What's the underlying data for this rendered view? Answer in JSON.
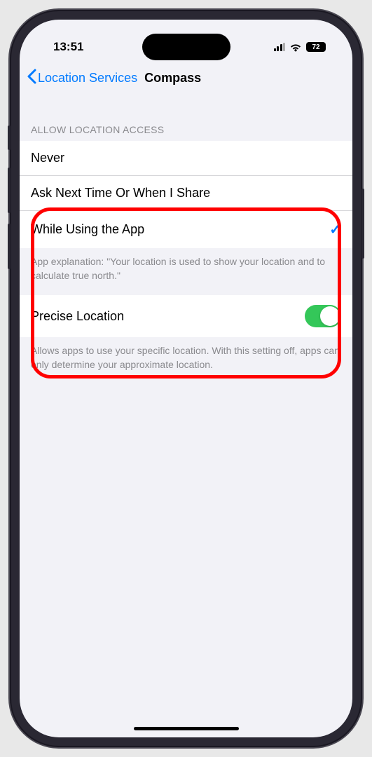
{
  "status": {
    "time": "13:51",
    "battery": "72"
  },
  "nav": {
    "back_label": "Location Services",
    "title": "Compass"
  },
  "section": {
    "header": "ALLOW LOCATION ACCESS",
    "options": {
      "never": "Never",
      "ask": "Ask Next Time Or When I Share",
      "while": "While Using the App"
    },
    "app_explanation": "App explanation: \"Your location is used to show your location and to calculate true north.\""
  },
  "precise": {
    "label": "Precise Location",
    "footer": "Allows apps to use your specific location. With this setting off, apps can only determine your approximate location."
  }
}
